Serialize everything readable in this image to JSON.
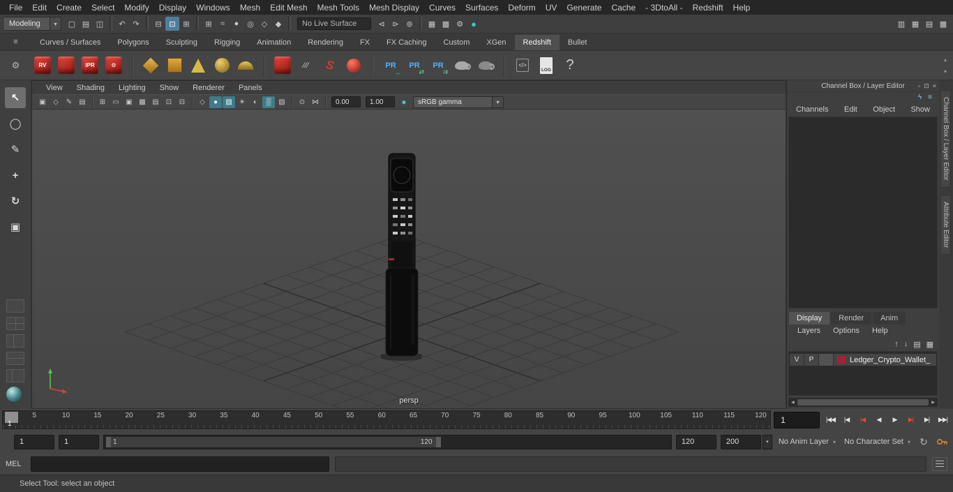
{
  "window": {
    "help_line": "Select Tool: select an object"
  },
  "menubar": {
    "items": [
      "File",
      "Edit",
      "Create",
      "Select",
      "Modify",
      "Display",
      "Windows",
      "Mesh",
      "Edit Mesh",
      "Mesh Tools",
      "Mesh Display",
      "Curves",
      "Surfaces",
      "Deform",
      "UV",
      "Generate",
      "Cache",
      "- 3DtoAll -",
      "Redshift",
      "Help"
    ]
  },
  "statusline": {
    "mode": "Modeling",
    "live_surface": "No Live Surface",
    "left_icons": [
      {
        "name": "new-scene-icon",
        "glyph": "▢"
      },
      {
        "name": "open-scene-icon",
        "glyph": "▤"
      },
      {
        "name": "save-scene-icon",
        "glyph": "◫"
      },
      {
        "sep": true
      },
      {
        "name": "undo-icon",
        "glyph": "↶"
      },
      {
        "name": "redo-icon",
        "glyph": "↷"
      },
      {
        "sep": true
      },
      {
        "name": "select-hierarchy-icon",
        "glyph": "⊟"
      },
      {
        "name": "select-object-icon",
        "glyph": "⊡",
        "active": true
      },
      {
        "name": "select-component-icon",
        "glyph": "⊞"
      },
      {
        "sep": true
      },
      {
        "name": "snap-grid-icon",
        "glyph": "⊞"
      },
      {
        "name": "snap-curve-icon",
        "glyph": "≈"
      },
      {
        "name": "snap-point-icon",
        "glyph": "●"
      },
      {
        "name": "snap-projected-center-icon",
        "glyph": "◎"
      },
      {
        "name": "snap-view-plane-icon",
        "glyph": "◇"
      },
      {
        "name": "snap-surface-icon",
        "glyph": "◆"
      },
      {
        "sep": true
      }
    ],
    "mid_icons": [
      {
        "name": "input-connections-icon",
        "glyph": "⊲"
      },
      {
        "name": "output-connections-icon",
        "glyph": "⊳"
      },
      {
        "name": "construction-history-icon",
        "glyph": "⊚"
      },
      {
        "sep": true
      },
      {
        "name": "render-frame-icon",
        "glyph": "▦"
      },
      {
        "name": "ipr-render-icon",
        "glyph": "▩"
      },
      {
        "name": "render-settings-icon",
        "glyph": "⚙"
      },
      {
        "name": "color-management-icon",
        "glyph": "●",
        "teal": true
      }
    ],
    "right_icons": [
      {
        "name": "outliner-toggle-icon",
        "glyph": "▥"
      },
      {
        "name": "channelbox-toggle-icon",
        "glyph": "▦"
      },
      {
        "name": "toolbox-toggle-icon",
        "glyph": "▤"
      },
      {
        "name": "workspace-selector-icon",
        "glyph": "▩"
      }
    ]
  },
  "shelf": {
    "menu_glyph": "≡",
    "gear_glyph": "⚙",
    "tabs": [
      "Curves / Surfaces",
      "Polygons",
      "Sculpting",
      "Rigging",
      "Animation",
      "Rendering",
      "FX",
      "FX Caching",
      "Custom",
      "XGen",
      "Redshift",
      "Bullet"
    ],
    "active_tab": "Redshift",
    "icons": [
      {
        "kind": "redcube",
        "label": "RV",
        "name": "rs-render-view-icon"
      },
      {
        "kind": "redcube",
        "label": "",
        "name": "rs-render-icon"
      },
      {
        "kind": "redcube",
        "label": "IPR",
        "name": "rs-ipr-icon"
      },
      {
        "kind": "redcube",
        "label": "⚙",
        "name": "rs-render-settings-icon"
      },
      {
        "kind": "sep"
      },
      {
        "kind": "diamond",
        "name": "rs-proxy-icon"
      },
      {
        "kind": "orangebox",
        "name": "rs-proxy-export-icon"
      },
      {
        "kind": "cone",
        "name": "rs-volume-icon"
      },
      {
        "kind": "spherestack",
        "name": "rs-dome-light-icon"
      },
      {
        "kind": "halfsphere",
        "name": "rs-sun-sky-icon"
      },
      {
        "kind": "sep"
      },
      {
        "kind": "redcube",
        "label": "",
        "name": "rs-object-set-icon"
      },
      {
        "kind": "slashes",
        "label": "∕∕∕",
        "name": "rs-hair-icon"
      },
      {
        "kind": "curl",
        "label": "S",
        "name": "rs-curve-icon"
      },
      {
        "kind": "redsphere",
        "name": "rs-sphere-icon"
      },
      {
        "kind": "sep"
      },
      {
        "kind": "pr",
        "label": "PR",
        "sub": "→",
        "name": "rs-proxy-open-icon"
      },
      {
        "kind": "pr",
        "label": "PR",
        "sub": "⇄",
        "name": "rs-proxy-exchange-icon"
      },
      {
        "kind": "pr",
        "label": "PR",
        "sub": "⇉",
        "name": "rs-proxy-update-icon"
      },
      {
        "kind": "teapot",
        "name": "rs-material-icon"
      },
      {
        "kind": "teapot2",
        "name": "rs-material-blend-icon"
      },
      {
        "kind": "sep"
      },
      {
        "kind": "code",
        "label": "</>",
        "name": "rs-script-icon"
      },
      {
        "kind": "doc",
        "label": "LOG",
        "name": "rs-log-icon"
      },
      {
        "kind": "help",
        "label": "?",
        "name": "rs-help-icon"
      }
    ]
  },
  "toolbox": {
    "tools": [
      {
        "name": "select-tool",
        "glyph": "↖",
        "active": true
      },
      {
        "name": "lasso-select-tool",
        "glyph": "◯"
      },
      {
        "name": "paint-select-tool",
        "glyph": "✎"
      },
      {
        "name": "move-tool",
        "glyph": "+"
      },
      {
        "name": "rotate-tool",
        "glyph": "↻"
      },
      {
        "name": "scale-tool",
        "glyph": "▣"
      }
    ],
    "layouts": [
      {
        "name": "single-pane-layout-button",
        "kind": "single"
      },
      {
        "name": "four-pane-layout-button",
        "kind": "four"
      },
      {
        "name": "two-pane-side-layout-button",
        "kind": "lr"
      },
      {
        "name": "two-pane-stacked-layout-button",
        "kind": "tb"
      },
      {
        "name": "outliner-persp-layout-button",
        "kind": "outliner"
      },
      {
        "name": "layout-shortcuts-ball",
        "kind": "ball"
      }
    ]
  },
  "viewport": {
    "menus": [
      "View",
      "Shading",
      "Lighting",
      "Show",
      "Renderer",
      "Panels"
    ],
    "cam_label": "persp",
    "toolbar": [
      {
        "name": "select-camera-icon",
        "glyph": "▣"
      },
      {
        "name": "lock-camera-icon",
        "glyph": "◇"
      },
      {
        "name": "camera-attributes-icon",
        "glyph": "✎"
      },
      {
        "name": "bookmarks-icon",
        "glyph": "▤"
      },
      {
        "sep": true
      },
      {
        "name": "grid-toggle-icon",
        "glyph": "⊞"
      },
      {
        "name": "film-gate-icon",
        "glyph": "▭"
      },
      {
        "name": "resolution-gate-icon",
        "glyph": "▣"
      },
      {
        "name": "gate-mask-icon",
        "glyph": "▩"
      },
      {
        "name": "field-chart-icon",
        "glyph": "▤"
      },
      {
        "name": "safe-action-icon",
        "glyph": "⊡"
      },
      {
        "name": "safe-title-icon",
        "glyph": "⊟"
      },
      {
        "sep": true
      },
      {
        "name": "wireframe-icon",
        "glyph": "◇"
      },
      {
        "name": "smooth-shade-icon",
        "glyph": "●",
        "active": true
      },
      {
        "name": "textured-icon",
        "glyph": "▧",
        "active": true
      },
      {
        "name": "use-all-lights-icon",
        "glyph": "☀"
      },
      {
        "name": "shadows-icon",
        "glyph": "◐"
      },
      {
        "name": "ambient-occlusion-icon",
        "glyph": "▒",
        "active": true
      },
      {
        "name": "anti-alias-icon",
        "glyph": "▨"
      },
      {
        "sep": true
      },
      {
        "name": "isolate-select-icon",
        "glyph": "⊙"
      },
      {
        "name": "xray-icon",
        "glyph": "⋈"
      },
      {
        "sep": true
      },
      {
        "name": "exposure-field",
        "field": true,
        "value": "0.00"
      },
      {
        "name": "gamma-field",
        "field": true,
        "value": "1.00"
      },
      {
        "name": "color-managed-toggle-icon",
        "glyph": "●",
        "teal": true
      },
      {
        "name": "view-transform-select",
        "select": true,
        "value": "sRGB gamma"
      }
    ]
  },
  "channel_box": {
    "title": "Channel Box / Layer Editor",
    "title_icons": [
      {
        "name": "pin-icon",
        "glyph": "▫"
      },
      {
        "name": "popout-icon",
        "glyph": "⊡"
      },
      {
        "name": "close-icon",
        "glyph": "×"
      }
    ],
    "tool_icons": [
      {
        "name": "display-speed-icon",
        "glyph": "ϟ"
      },
      {
        "name": "channel-settings-icon",
        "glyph": "≡"
      }
    ],
    "menus": [
      "Channels",
      "Edit",
      "Object",
      "Show"
    ]
  },
  "layer_editor": {
    "tabs": [
      "Display",
      "Render",
      "Anim"
    ],
    "active_tab": "Display",
    "menus": [
      "Layers",
      "Options",
      "Help"
    ],
    "icons": [
      {
        "name": "move-layer-up-icon",
        "glyph": "↑"
      },
      {
        "name": "move-layer-down-icon",
        "glyph": "↓"
      },
      {
        "name": "create-empty-layer-icon",
        "glyph": "▤"
      },
      {
        "name": "create-layer-from-selected-icon",
        "glyph": "▦"
      }
    ],
    "layer": {
      "v": "V",
      "p": "P",
      "color": "#a32035",
      "name": "Ledger_Crypto_Wallet_"
    }
  },
  "right_strip": {
    "tabs": [
      "Channel Box / Layer Editor",
      "Attribute Editor"
    ]
  },
  "timeline": {
    "ticks": [
      5,
      10,
      15,
      20,
      25,
      30,
      35,
      40,
      45,
      50,
      55,
      60,
      65,
      70,
      75,
      80,
      85,
      90,
      95,
      100,
      105,
      110,
      115,
      120
    ],
    "current_frame": "1",
    "frame_field": "1",
    "playback": [
      {
        "name": "go-to-start-button",
        "glyph": "|◀◀"
      },
      {
        "name": "step-back-frame-button",
        "glyph": "|◀"
      },
      {
        "name": "step-back-key-button",
        "glyph": "|◀",
        "red": true
      },
      {
        "name": "play-backwards-button",
        "glyph": "◀"
      },
      {
        "name": "play-forwards-button",
        "glyph": "▶"
      },
      {
        "name": "step-forward-key-button",
        "glyph": "▶|",
        "red": true
      },
      {
        "name": "step-forward-frame-button",
        "glyph": "▶|"
      },
      {
        "name": "go-to-end-button",
        "glyph": "▶▶|"
      }
    ]
  },
  "range": {
    "animation_start": "1",
    "playback_start": "1",
    "bar_start_label": "1",
    "bar_end_label": "120",
    "playback_end": "120",
    "animation_end": "200",
    "anim_layer": "No Anim Layer",
    "character_set": "No Character Set",
    "playback_speed_glyph": "↻"
  },
  "command_line": {
    "label": "MEL"
  },
  "colors": {
    "viewport_bg": "#4a4a4a",
    "accent_teal": "#3f7b8a",
    "shelf_red": "#c1272d",
    "layer_swatch": "#a32035",
    "key_red": "#e04a31"
  }
}
